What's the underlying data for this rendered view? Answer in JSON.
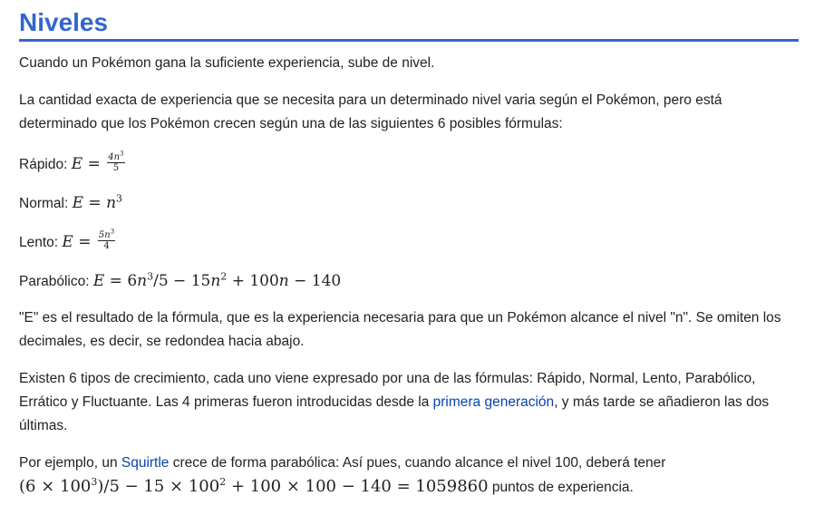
{
  "section": {
    "title": "Niveles"
  },
  "intro": "Cuando un Pokémon gana la suficiente experiencia, sube de nivel.",
  "formulas_intro": "La cantidad exacta de experiencia que se necesita para un determinado nivel varia según el Pokémon, pero está determinado que los Pokémon crecen según una de las siguientes 6 posibles fórmulas:",
  "formulas": {
    "rapido_label": "Rápido:",
    "rapido_lhs": "E",
    "rapido_eq": " = ",
    "rapido_num": "4n",
    "rapido_exp": "3",
    "rapido_den": "5",
    "normal_label": "Normal:",
    "normal_lhs": "E",
    "normal_eq": " = ",
    "normal_base": "n",
    "normal_exp": "3",
    "lento_label": "Lento:",
    "lento_lhs": "E",
    "lento_eq": " = ",
    "lento_num": "5n",
    "lento_exp": "3",
    "lento_den": "4",
    "parabolico_label": "Parabólico:",
    "parabolico_lhs": "E",
    "parabolico_part1": " = 6",
    "parabolico_n1": "n",
    "parabolico_exp1": "3",
    "parabolico_part2": "/5 − 15",
    "parabolico_n2": "n",
    "parabolico_exp2": "2",
    "parabolico_part3": " + 100",
    "parabolico_n3": "n",
    "parabolico_part4": " − 140"
  },
  "explanation": "\"E\" es el resultado de la fórmula, que es la experiencia necesaria para que un Pokémon alcance el nivel \"n\". Se omiten los decimales, es decir, se redondea hacia abajo.",
  "types_paragraph": {
    "before_link": "Existen 6 tipos de crecimiento, cada uno viene expresado por una de las fórmulas: Rápido, Normal, Lento, Parabólico, Errático y Fluctuante. Las 4 primeras fueron introducidas desde la ",
    "link_text": "primera generación",
    "after_link": ", y más tarde se añadieron las dos últimas."
  },
  "example": {
    "before_link": "Por ejemplo, un ",
    "link_text": "Squirtle",
    "after_link": " crece de forma parabólica: Así pues, cuando alcance el nivel 100, deberá tener",
    "math_part1": "(6 × 100",
    "math_exp1": "3",
    "math_part2": ")/5 − 15 × 100",
    "math_exp2": "2",
    "math_part3": " + 100 × 100 − 140 = 1059860",
    "suffix": " puntos de experiencia."
  }
}
